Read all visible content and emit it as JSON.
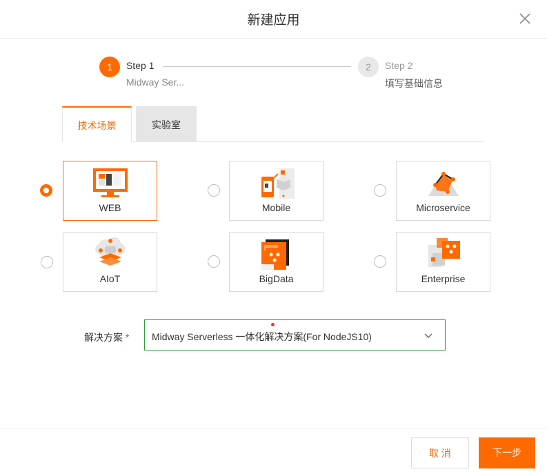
{
  "dialog": {
    "title": "新建应用"
  },
  "steps": [
    {
      "number": "1",
      "title": "Step 1",
      "desc": "Midway Ser..."
    },
    {
      "number": "2",
      "title": "Step 2",
      "desc": "填写基础信息"
    }
  ],
  "tabs": [
    {
      "label": "技术场景"
    },
    {
      "label": "实验室"
    }
  ],
  "scenarios": [
    {
      "label": "WEB",
      "icon": "web-monitor-icon"
    },
    {
      "label": "Mobile",
      "icon": "mobile-icon"
    },
    {
      "label": "Microservice",
      "icon": "microservice-icon"
    },
    {
      "label": "AIoT",
      "icon": "aiot-icon"
    },
    {
      "label": "BigData",
      "icon": "bigdata-icon"
    },
    {
      "label": "Enterprise",
      "icon": "enterprise-icon"
    }
  ],
  "solution": {
    "label": "解决方案",
    "required_mark": "*",
    "value": "Midway Serverless 一体化解决方案(For NodeJS10)"
  },
  "footer": {
    "cancel": "取 消",
    "next": "下一步"
  },
  "colors": {
    "accent": "#ff6a00",
    "focus_border": "#2e9c3b"
  }
}
